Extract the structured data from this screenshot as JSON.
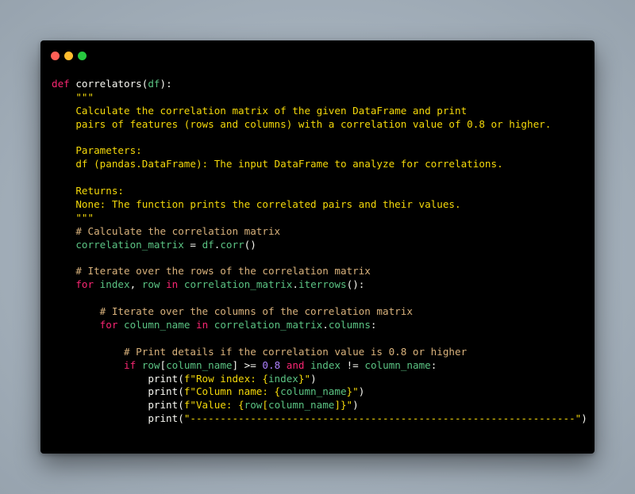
{
  "window": {
    "controls": [
      "close",
      "minimize",
      "maximize"
    ],
    "colors": {
      "close": "#ff5f56",
      "minimize": "#ffbd2e",
      "maximize": "#27c93f",
      "background": "#000000"
    }
  },
  "code": {
    "language": "python",
    "lines": [
      [
        [
          "kw",
          "def "
        ],
        [
          "fn",
          "correlators("
        ],
        [
          "id",
          "df"
        ],
        [
          "fn",
          "):"
        ]
      ],
      [
        [
          "doc",
          "    \"\"\""
        ]
      ],
      [
        [
          "doc",
          "    Calculate the correlation matrix of the given DataFrame and print"
        ]
      ],
      [
        [
          "doc",
          "    pairs of features (rows and columns) with a correlation value of 0.8 or higher."
        ]
      ],
      [
        [
          "doc",
          ""
        ]
      ],
      [
        [
          "doc",
          "    Parameters:"
        ]
      ],
      [
        [
          "doc",
          "    df (pandas.DataFrame): The input DataFrame to analyze for correlations."
        ]
      ],
      [
        [
          "doc",
          ""
        ]
      ],
      [
        [
          "doc",
          "    Returns:"
        ]
      ],
      [
        [
          "doc",
          "    None: The function prints the correlated pairs and their values."
        ]
      ],
      [
        [
          "doc",
          "    \"\"\""
        ]
      ],
      [
        [
          "cm",
          "    # Calculate the correlation matrix"
        ]
      ],
      [
        [
          "id",
          "    correlation_matrix"
        ],
        [
          "op",
          " = "
        ],
        [
          "id",
          "df"
        ],
        [
          "pl",
          "."
        ],
        [
          "id",
          "corr"
        ],
        [
          "pl",
          "()"
        ]
      ],
      [
        [
          "pl",
          ""
        ]
      ],
      [
        [
          "cm",
          "    # Iterate over the rows of the correlation matrix"
        ]
      ],
      [
        [
          "kw",
          "    for "
        ],
        [
          "id",
          "index"
        ],
        [
          "pl",
          ", "
        ],
        [
          "id",
          "row"
        ],
        [
          "kw",
          " in "
        ],
        [
          "id",
          "correlation_matrix"
        ],
        [
          "pl",
          "."
        ],
        [
          "id",
          "iterrows"
        ],
        [
          "pl",
          "():"
        ]
      ],
      [
        [
          "pl",
          ""
        ]
      ],
      [
        [
          "cm",
          "        # Iterate over the columns of the correlation matrix"
        ]
      ],
      [
        [
          "kw",
          "        for "
        ],
        [
          "id",
          "column_name"
        ],
        [
          "kw",
          " in "
        ],
        [
          "id",
          "correlation_matrix"
        ],
        [
          "pl",
          "."
        ],
        [
          "id",
          "columns"
        ],
        [
          "pl",
          ":"
        ]
      ],
      [
        [
          "pl",
          ""
        ]
      ],
      [
        [
          "cm",
          "            # Print details if the correlation value is 0.8 or higher"
        ]
      ],
      [
        [
          "kw",
          "            if "
        ],
        [
          "id",
          "row"
        ],
        [
          "pl",
          "["
        ],
        [
          "id",
          "column_name"
        ],
        [
          "pl",
          "] "
        ],
        [
          "op",
          ">="
        ],
        [
          "pl",
          " "
        ],
        [
          "num",
          "0.8"
        ],
        [
          "kw",
          " and "
        ],
        [
          "id",
          "index"
        ],
        [
          "op",
          " != "
        ],
        [
          "id",
          "column_name"
        ],
        [
          "pl",
          ":"
        ]
      ],
      [
        [
          "pl",
          "                print("
        ],
        [
          "str",
          "f\"Row index: {"
        ],
        [
          "id",
          "index"
        ],
        [
          "str",
          "}\""
        ],
        [
          "pl",
          ")"
        ]
      ],
      [
        [
          "pl",
          "                print("
        ],
        [
          "str",
          "f\"Column name: {"
        ],
        [
          "id",
          "column_name"
        ],
        [
          "str",
          "}\""
        ],
        [
          "pl",
          ")"
        ]
      ],
      [
        [
          "pl",
          "                print("
        ],
        [
          "str",
          "f\"Value: {"
        ],
        [
          "id",
          "row"
        ],
        [
          "str",
          "["
        ],
        [
          "id",
          "column_name"
        ],
        [
          "str",
          "]}\""
        ],
        [
          "pl",
          ")"
        ]
      ],
      [
        [
          "pl",
          "                print("
        ],
        [
          "str",
          "\"----------------------------------------------------------------\""
        ],
        [
          "pl",
          ")"
        ]
      ]
    ]
  },
  "colors": {
    "keyword": "#f92672",
    "identifier": "#5bc383",
    "string": "#f5d90a",
    "comment": "#d9b27c",
    "number": "#ae81ff",
    "plain": "#f8f8f2"
  }
}
